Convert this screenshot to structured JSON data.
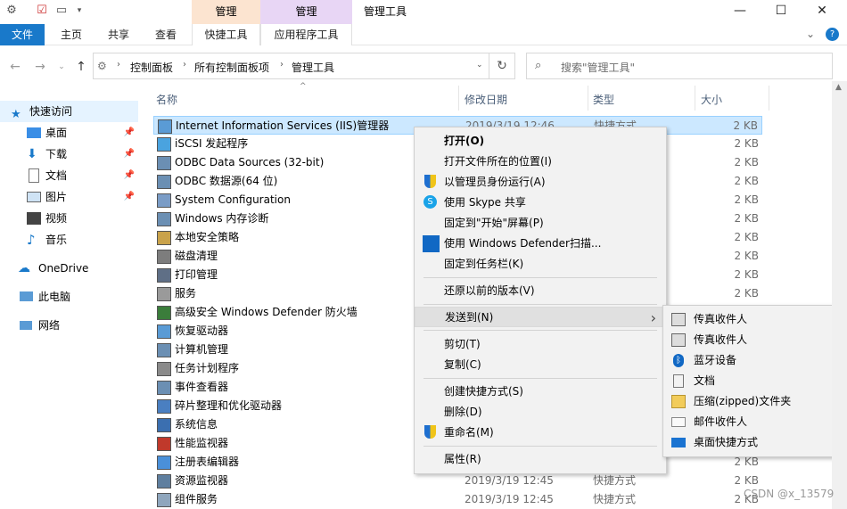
{
  "window": {
    "title": "管理工具",
    "ctx_group1": "管理",
    "ctx_group2": "管理",
    "minimize": "—",
    "maximize": "☐",
    "close": "✕"
  },
  "ribbon": {
    "tabs": [
      "文件",
      "主页",
      "共享",
      "查看",
      "快捷工具",
      "应用程序工具"
    ],
    "chevron": "⌄",
    "help": "?"
  },
  "address": {
    "crumbs": [
      "控制面板",
      "所有控制面板项",
      "管理工具"
    ],
    "search_placeholder": "搜索\"管理工具\""
  },
  "nav": {
    "quick_access": "快速访问",
    "items": [
      {
        "label": "桌面",
        "pinned": true
      },
      {
        "label": "下载",
        "pinned": true
      },
      {
        "label": "文档",
        "pinned": true
      },
      {
        "label": "图片",
        "pinned": true
      },
      {
        "label": "视频",
        "pinned": false
      },
      {
        "label": "音乐",
        "pinned": false
      }
    ],
    "onedrive": "OneDrive",
    "this_pc": "此电脑",
    "network": "网络"
  },
  "columns": {
    "name": "名称",
    "date": "修改日期",
    "type": "类型",
    "size": "大小"
  },
  "files": [
    {
      "name": "Internet Information Services (IIS)管理器",
      "date": "2019/3/19 12:46",
      "type": "快捷方式",
      "size": "2 KB"
    },
    {
      "name": "iSCSI 发起程序",
      "date": "",
      "type": "",
      "size": "2 KB"
    },
    {
      "name": "ODBC Data Sources (32-bit)",
      "date": "",
      "type": "",
      "size": "2 KB"
    },
    {
      "name": "ODBC 数据源(64 位)",
      "date": "",
      "type": "",
      "size": "2 KB"
    },
    {
      "name": "System Configuration",
      "date": "",
      "type": "",
      "size": "2 KB"
    },
    {
      "name": "Windows 内存诊断",
      "date": "",
      "type": "",
      "size": "2 KB"
    },
    {
      "name": "本地安全策略",
      "date": "",
      "type": "",
      "size": "2 KB"
    },
    {
      "name": "磁盘清理",
      "date": "",
      "type": "",
      "size": "2 KB"
    },
    {
      "name": "打印管理",
      "date": "",
      "type": "",
      "size": "2 KB"
    },
    {
      "name": "服务",
      "date": "",
      "type": "",
      "size": "2 KB"
    },
    {
      "name": "高级安全 Windows Defender 防火墙",
      "date": "",
      "type": "",
      "size": ""
    },
    {
      "name": "恢复驱动器",
      "date": "",
      "type": "",
      "size": ""
    },
    {
      "name": "计算机管理",
      "date": "",
      "type": "",
      "size": ""
    },
    {
      "name": "任务计划程序",
      "date": "",
      "type": "",
      "size": ""
    },
    {
      "name": "事件查看器",
      "date": "",
      "type": "",
      "size": ""
    },
    {
      "name": "碎片整理和优化驱动器",
      "date": "",
      "type": "",
      "size": ""
    },
    {
      "name": "系统信息",
      "date": "",
      "type": "",
      "size": ""
    },
    {
      "name": "性能监视器",
      "date": "",
      "type": "",
      "size": ""
    },
    {
      "name": "注册表编辑器",
      "date": "",
      "type": "",
      "size": "2 KB"
    },
    {
      "name": "资源监视器",
      "date": "2019/3/19 12:45",
      "type": "快捷方式",
      "size": "2 KB"
    },
    {
      "name": "组件服务",
      "date": "2019/3/19 12:45",
      "type": "快捷方式",
      "size": "2 KB"
    }
  ],
  "context_menu": {
    "items": [
      "打开(O)",
      "打开文件所在的位置(I)",
      "以管理员身份运行(A)",
      "使用 Skype 共享",
      "固定到\"开始\"屏幕(P)",
      "使用 Windows Defender扫描...",
      "固定到任务栏(K)",
      "还原以前的版本(V)",
      "发送到(N)",
      "剪切(T)",
      "复制(C)",
      "创建快捷方式(S)",
      "删除(D)",
      "重命名(M)",
      "属性(R)"
    ],
    "submenu_arrow": "›"
  },
  "sendto_menu": {
    "items": [
      "传真收件人",
      "传真收件人",
      "蓝牙设备",
      "文档",
      "压缩(zipped)文件夹",
      "邮件收件人",
      "桌面快捷方式"
    ]
  },
  "watermark": "CSDN @x_13579",
  "colors": {
    "accent": "#1979ca",
    "selection": "#cce8ff",
    "ctx_manage1": "#fce4d0",
    "ctx_manage2": "#e8d6f5"
  }
}
